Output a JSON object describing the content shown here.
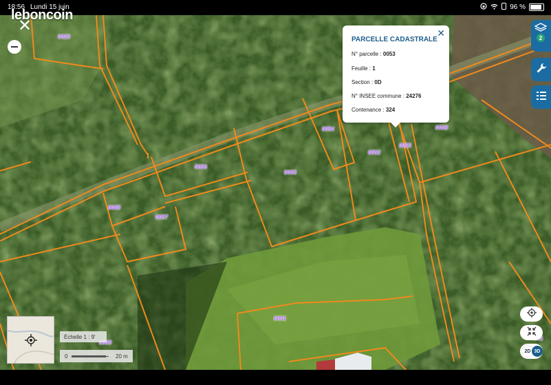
{
  "status_bar": {
    "time": "18:56",
    "date": "Lundi 15 juin",
    "battery": "96 %",
    "battery_level": 0.96
  },
  "app": {
    "logo": "leboncoin"
  },
  "parcel_popup": {
    "title": "PARCELLE CADASTRALE",
    "rows": [
      {
        "label": "N° parcelle :",
        "value": "0053"
      },
      {
        "label": "Feuille :",
        "value": "1"
      },
      {
        "label": "Section :",
        "value": "0D"
      },
      {
        "label": "N° INSEE commune :",
        "value": "24276"
      },
      {
        "label": "Contenance :",
        "value": "324"
      }
    ]
  },
  "map": {
    "parcel_line_color": "#f08a1c",
    "label_color": "#b36cff",
    "parcel_labels": [
      "0029",
      "0054",
      "0036",
      "0053",
      "0052",
      "0056",
      "0055",
      "0058",
      "0057",
      "0051",
      "0059",
      "041"
    ]
  },
  "controls": {
    "layers_badge": "2",
    "view_2d": "2D",
    "view_3d": "3D",
    "icons": [
      "close-icon",
      "zoom-out-icon",
      "layers-icon",
      "wrench-icon",
      "legend-list-icon",
      "locate-icon",
      "fullscreen-icon"
    ]
  },
  "scale": {
    "label": "Échelle 1 :   9'",
    "zero": "0",
    "distance": "20 m"
  }
}
